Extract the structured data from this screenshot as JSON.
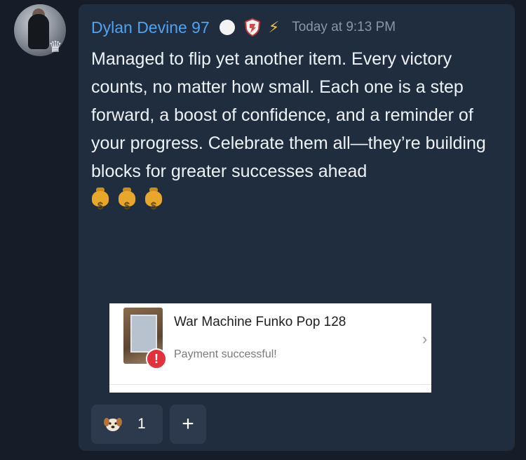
{
  "message": {
    "author": "Dylan Devine 97",
    "timestamp": "Today at 9:13 PM",
    "text": "Managed to flip yet another item. Every victory counts, no matter how small. Each one is a step forward, a boost of confidence, and a reminder of your progress. Celebrate them all—they’re building blocks for greater successes ahead",
    "emojis": [
      "money-bag-icon",
      "money-bag-icon",
      "money-bag-icon"
    ]
  },
  "embed": {
    "title": "War Machine Funko Pop 128",
    "status": "Payment successful!",
    "alert_glyph": "!",
    "chevron_glyph": "›"
  },
  "badges": {
    "bolt_glyph": "⚡"
  },
  "reactions": {
    "items": [
      {
        "icon": "dog-face-icon",
        "count": "1"
      }
    ],
    "add_glyph": "+"
  },
  "colors": {
    "background": "#161d29",
    "card": "#202d3f",
    "username": "#4ea3f1",
    "timestamp": "#8a96a6",
    "reaction_pill": "#2d3a4e"
  }
}
